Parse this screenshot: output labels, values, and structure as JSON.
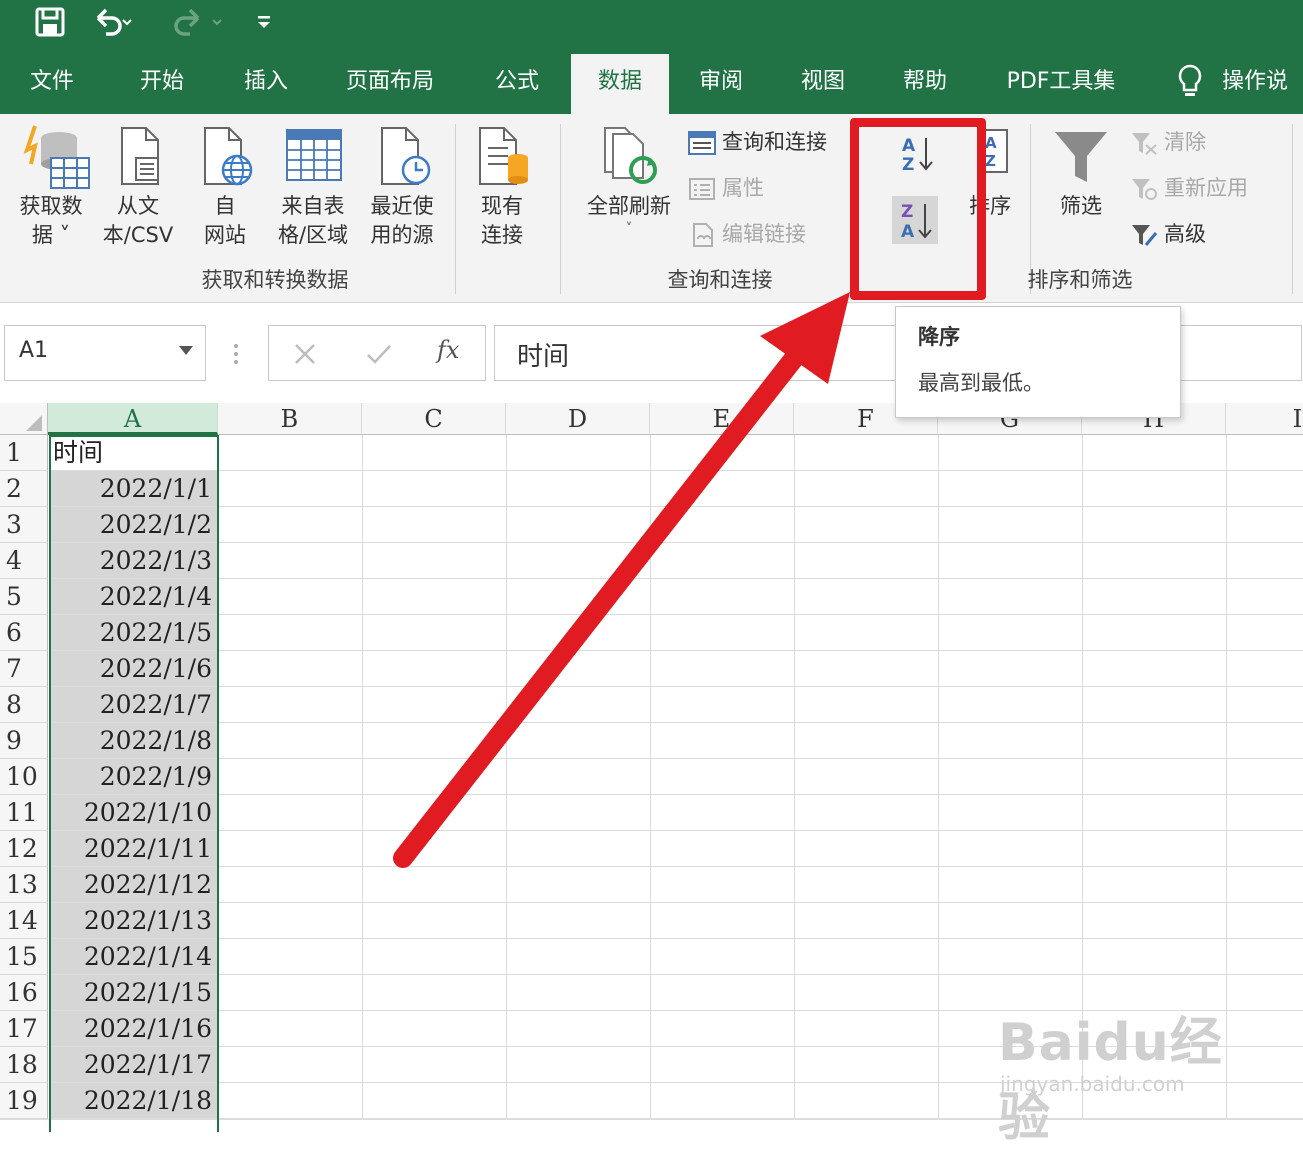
{
  "quick_access": {
    "save_icon": "save-icon",
    "undo_icon": "undo-icon",
    "redo_icon": "redo-icon",
    "customize_icon": "customize-qat-icon"
  },
  "tabs": [
    {
      "label": "文件"
    },
    {
      "label": "开始"
    },
    {
      "label": "插入"
    },
    {
      "label": "页面布局"
    },
    {
      "label": "公式"
    },
    {
      "label": "数据"
    },
    {
      "label": "审阅"
    },
    {
      "label": "视图"
    },
    {
      "label": "帮助"
    },
    {
      "label": "PDF工具集"
    },
    {
      "label": "操作说"
    }
  ],
  "active_tab": "数据",
  "ribbon": {
    "get_transform": {
      "get_data_l1": "获取数",
      "get_data_l2": "据",
      "from_text_l1": "从文",
      "from_text_l2": "本/CSV",
      "from_web_l1": "自",
      "from_web_l2": "网站",
      "from_table_l1": "来自表",
      "from_table_l2": "格/区域",
      "recent_l1": "最近使",
      "recent_l2": "用的源",
      "existing_l1": "现有",
      "existing_l2": "连接",
      "group_label": "获取和转换数据"
    },
    "queries": {
      "refresh_all": "全部刷新",
      "queries_connections": "查询和连接",
      "properties": "属性",
      "edit_links": "编辑链接",
      "group_label": "查询和连接"
    },
    "sort_filter": {
      "sort_label": "排序",
      "filter_label": "筛选",
      "clear": "清除",
      "reapply": "重新应用",
      "advanced": "高级",
      "group_label": "排序和筛选"
    }
  },
  "formula_bar": {
    "name_box": "A1",
    "fx_label": "fx",
    "content": "时间"
  },
  "tooltip": {
    "title": "降序",
    "description": "最高到最低。"
  },
  "columns": [
    "A",
    "B",
    "C",
    "D",
    "E",
    "F",
    "G",
    "H",
    "I"
  ],
  "rows": [
    {
      "num": "1",
      "a": "时间"
    },
    {
      "num": "2",
      "a": "2022/1/1"
    },
    {
      "num": "3",
      "a": "2022/1/2"
    },
    {
      "num": "4",
      "a": "2022/1/3"
    },
    {
      "num": "5",
      "a": "2022/1/4"
    },
    {
      "num": "6",
      "a": "2022/1/5"
    },
    {
      "num": "7",
      "a": "2022/1/6"
    },
    {
      "num": "8",
      "a": "2022/1/7"
    },
    {
      "num": "9",
      "a": "2022/1/8"
    },
    {
      "num": "10",
      "a": "2022/1/9"
    },
    {
      "num": "11",
      "a": "2022/1/10"
    },
    {
      "num": "12",
      "a": "2022/1/11"
    },
    {
      "num": "13",
      "a": "2022/1/12"
    },
    {
      "num": "14",
      "a": "2022/1/13"
    },
    {
      "num": "15",
      "a": "2022/1/14"
    },
    {
      "num": "16",
      "a": "2022/1/15"
    },
    {
      "num": "17",
      "a": "2022/1/16"
    },
    {
      "num": "18",
      "a": "2022/1/17"
    },
    {
      "num": "19",
      "a": "2022/1/18"
    }
  ],
  "watermark": {
    "logo": "Baidu经验",
    "url": "jingyan.baidu.com"
  },
  "colors": {
    "excel_green": "#217346",
    "annotation_red": "#e11b22",
    "selection_gray": "#d6d6d6"
  }
}
